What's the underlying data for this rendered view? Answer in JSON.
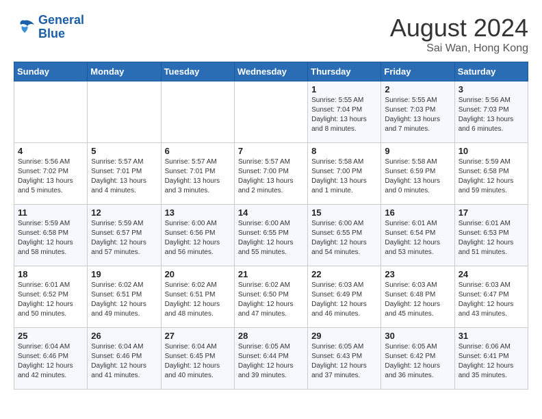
{
  "logo": {
    "line1": "General",
    "line2": "Blue"
  },
  "title": {
    "month_year": "August 2024",
    "location": "Sai Wan, Hong Kong"
  },
  "days_of_week": [
    "Sunday",
    "Monday",
    "Tuesday",
    "Wednesday",
    "Thursday",
    "Friday",
    "Saturday"
  ],
  "weeks": [
    [
      {
        "day": "",
        "info": ""
      },
      {
        "day": "",
        "info": ""
      },
      {
        "day": "",
        "info": ""
      },
      {
        "day": "",
        "info": ""
      },
      {
        "day": "1",
        "info": "Sunrise: 5:55 AM\nSunset: 7:04 PM\nDaylight: 13 hours\nand 8 minutes."
      },
      {
        "day": "2",
        "info": "Sunrise: 5:55 AM\nSunset: 7:03 PM\nDaylight: 13 hours\nand 7 minutes."
      },
      {
        "day": "3",
        "info": "Sunrise: 5:56 AM\nSunset: 7:03 PM\nDaylight: 13 hours\nand 6 minutes."
      }
    ],
    [
      {
        "day": "4",
        "info": "Sunrise: 5:56 AM\nSunset: 7:02 PM\nDaylight: 13 hours\nand 5 minutes."
      },
      {
        "day": "5",
        "info": "Sunrise: 5:57 AM\nSunset: 7:01 PM\nDaylight: 13 hours\nand 4 minutes."
      },
      {
        "day": "6",
        "info": "Sunrise: 5:57 AM\nSunset: 7:01 PM\nDaylight: 13 hours\nand 3 minutes."
      },
      {
        "day": "7",
        "info": "Sunrise: 5:57 AM\nSunset: 7:00 PM\nDaylight: 13 hours\nand 2 minutes."
      },
      {
        "day": "8",
        "info": "Sunrise: 5:58 AM\nSunset: 7:00 PM\nDaylight: 13 hours\nand 1 minute."
      },
      {
        "day": "9",
        "info": "Sunrise: 5:58 AM\nSunset: 6:59 PM\nDaylight: 13 hours\nand 0 minutes."
      },
      {
        "day": "10",
        "info": "Sunrise: 5:59 AM\nSunset: 6:58 PM\nDaylight: 12 hours\nand 59 minutes."
      }
    ],
    [
      {
        "day": "11",
        "info": "Sunrise: 5:59 AM\nSunset: 6:58 PM\nDaylight: 12 hours\nand 58 minutes."
      },
      {
        "day": "12",
        "info": "Sunrise: 5:59 AM\nSunset: 6:57 PM\nDaylight: 12 hours\nand 57 minutes."
      },
      {
        "day": "13",
        "info": "Sunrise: 6:00 AM\nSunset: 6:56 PM\nDaylight: 12 hours\nand 56 minutes."
      },
      {
        "day": "14",
        "info": "Sunrise: 6:00 AM\nSunset: 6:55 PM\nDaylight: 12 hours\nand 55 minutes."
      },
      {
        "day": "15",
        "info": "Sunrise: 6:00 AM\nSunset: 6:55 PM\nDaylight: 12 hours\nand 54 minutes."
      },
      {
        "day": "16",
        "info": "Sunrise: 6:01 AM\nSunset: 6:54 PM\nDaylight: 12 hours\nand 53 minutes."
      },
      {
        "day": "17",
        "info": "Sunrise: 6:01 AM\nSunset: 6:53 PM\nDaylight: 12 hours\nand 51 minutes."
      }
    ],
    [
      {
        "day": "18",
        "info": "Sunrise: 6:01 AM\nSunset: 6:52 PM\nDaylight: 12 hours\nand 50 minutes."
      },
      {
        "day": "19",
        "info": "Sunrise: 6:02 AM\nSunset: 6:51 PM\nDaylight: 12 hours\nand 49 minutes."
      },
      {
        "day": "20",
        "info": "Sunrise: 6:02 AM\nSunset: 6:51 PM\nDaylight: 12 hours\nand 48 minutes."
      },
      {
        "day": "21",
        "info": "Sunrise: 6:02 AM\nSunset: 6:50 PM\nDaylight: 12 hours\nand 47 minutes."
      },
      {
        "day": "22",
        "info": "Sunrise: 6:03 AM\nSunset: 6:49 PM\nDaylight: 12 hours\nand 46 minutes."
      },
      {
        "day": "23",
        "info": "Sunrise: 6:03 AM\nSunset: 6:48 PM\nDaylight: 12 hours\nand 45 minutes."
      },
      {
        "day": "24",
        "info": "Sunrise: 6:03 AM\nSunset: 6:47 PM\nDaylight: 12 hours\nand 43 minutes."
      }
    ],
    [
      {
        "day": "25",
        "info": "Sunrise: 6:04 AM\nSunset: 6:46 PM\nDaylight: 12 hours\nand 42 minutes."
      },
      {
        "day": "26",
        "info": "Sunrise: 6:04 AM\nSunset: 6:46 PM\nDaylight: 12 hours\nand 41 minutes."
      },
      {
        "day": "27",
        "info": "Sunrise: 6:04 AM\nSunset: 6:45 PM\nDaylight: 12 hours\nand 40 minutes."
      },
      {
        "day": "28",
        "info": "Sunrise: 6:05 AM\nSunset: 6:44 PM\nDaylight: 12 hours\nand 39 minutes."
      },
      {
        "day": "29",
        "info": "Sunrise: 6:05 AM\nSunset: 6:43 PM\nDaylight: 12 hours\nand 37 minutes."
      },
      {
        "day": "30",
        "info": "Sunrise: 6:05 AM\nSunset: 6:42 PM\nDaylight: 12 hours\nand 36 minutes."
      },
      {
        "day": "31",
        "info": "Sunrise: 6:06 AM\nSunset: 6:41 PM\nDaylight: 12 hours\nand 35 minutes."
      }
    ]
  ]
}
